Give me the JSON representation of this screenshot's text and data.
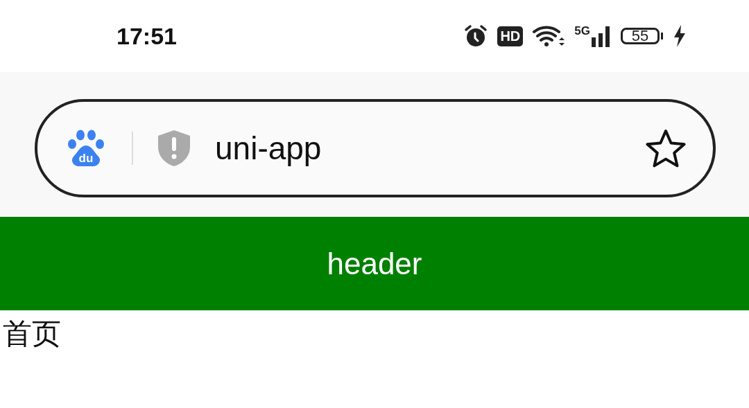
{
  "status_bar": {
    "time": "17:51",
    "hd_badge": "HD",
    "network": "5G",
    "battery": "55"
  },
  "address_bar": {
    "logo_text": "du",
    "url": "uni-app"
  },
  "header": {
    "title": "header"
  },
  "content": {
    "text": "首页"
  }
}
